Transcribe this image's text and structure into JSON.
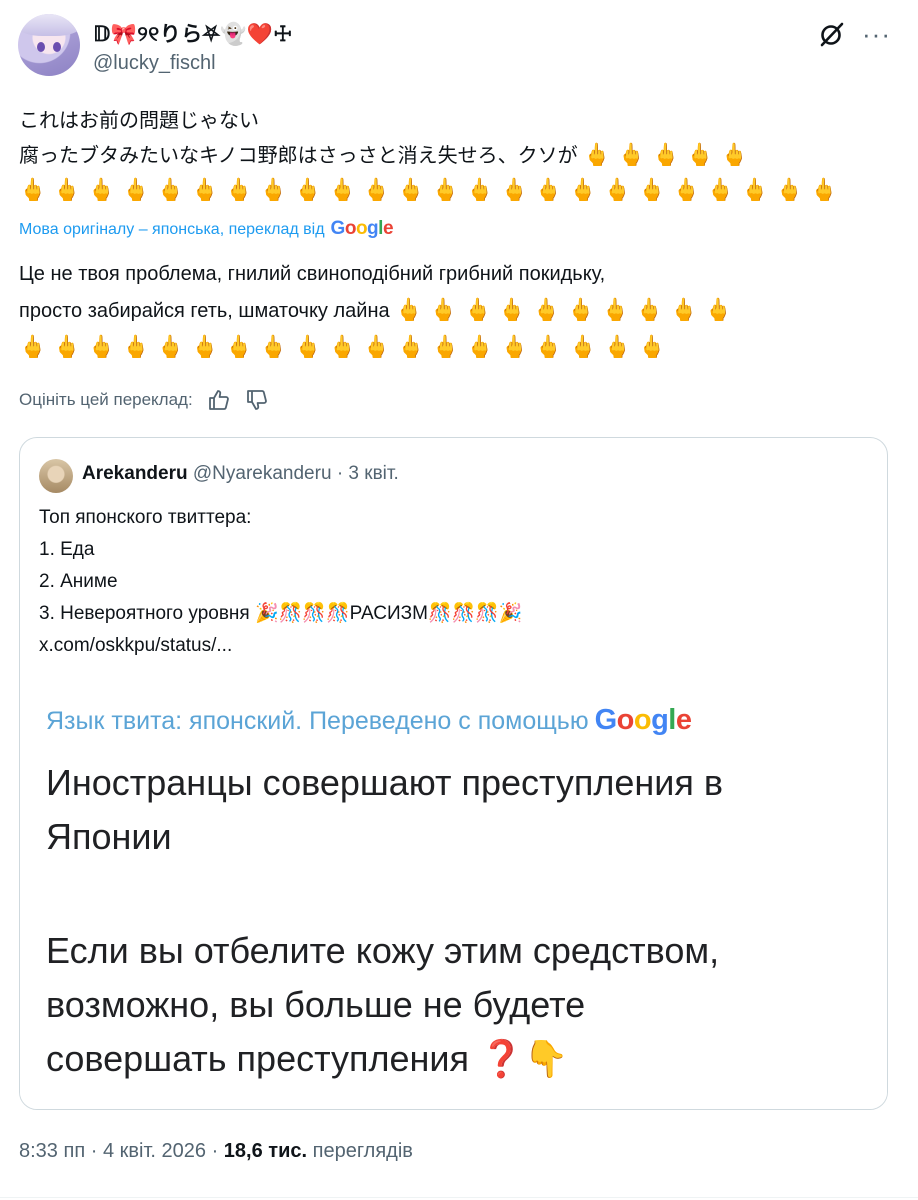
{
  "post": {
    "author": {
      "display_name": "𝔻🎀୨୧りら⛧👻❤️☩",
      "handle": "@lucky_fischl",
      "avatar_icon": "anime-avatar"
    },
    "text_lines": [
      "これはお前の問題じゃない",
      "腐ったブタみたいなキノコ野郎はさっさと消え失せろ、クソが"
    ],
    "finger_emoji_row1": "🖕🖕🖕🖕🖕",
    "finger_emoji_row2": "🖕🖕🖕🖕🖕🖕🖕🖕🖕🖕🖕🖕🖕🖕🖕🖕🖕🖕🖕🖕🖕🖕🖕🖕",
    "translated_by": "Мова оригіналу – японська, переклад від",
    "translation_lines": [
      "Це не твоя проблема, гнилий свиноподібний грибний покидьку,",
      "просто забирайся геть, шматочку лайна"
    ],
    "translation_fingers_row1": "🖕🖕🖕🖕🖕🖕🖕🖕🖕🖕",
    "translation_fingers_row2": "🖕🖕🖕🖕🖕🖕🖕🖕🖕🖕🖕🖕🖕🖕🖕🖕🖕🖕🖕",
    "rate_label": "Оцініть цей переклад:",
    "quote": {
      "name": "Arekanderu",
      "handle": "@Nyarekanderu",
      "date": "3 квіт.",
      "lines": [
        "Топ японского твиттера:",
        "1. Еда",
        "2. Аниме",
        "3. Невероятного уровня 🎉🎊🎊🎊РАСИЗМ🎊🎊🎊🎉",
        "x.com/oskkpu/status/..."
      ],
      "image": {
        "lang_line": "Язык твита: японский. Переведено с помощью",
        "paragraph1": [
          "Иностранцы совершают преступления в",
          "Японии"
        ],
        "paragraph2": [
          "Если вы отбелите кожу этим средством,",
          "возможно, вы больше не будете",
          "совершать преступления"
        ],
        "trailing_emoji": "❓👇"
      }
    },
    "time": "8:33 пп",
    "date": "4 квіт. 2026",
    "views_count": "18,6 тис.",
    "views_label": "переглядів"
  },
  "google_logo": [
    "G",
    "o",
    "o",
    "g",
    "l",
    "e"
  ],
  "colors": {
    "link_blue": "#1d9bf0",
    "secondary_text": "#536471",
    "border": "#cfd9de",
    "google_blue": "#4285f4",
    "google_red": "#ea4335",
    "google_yellow": "#fbbc05",
    "google_green": "#34a853"
  }
}
